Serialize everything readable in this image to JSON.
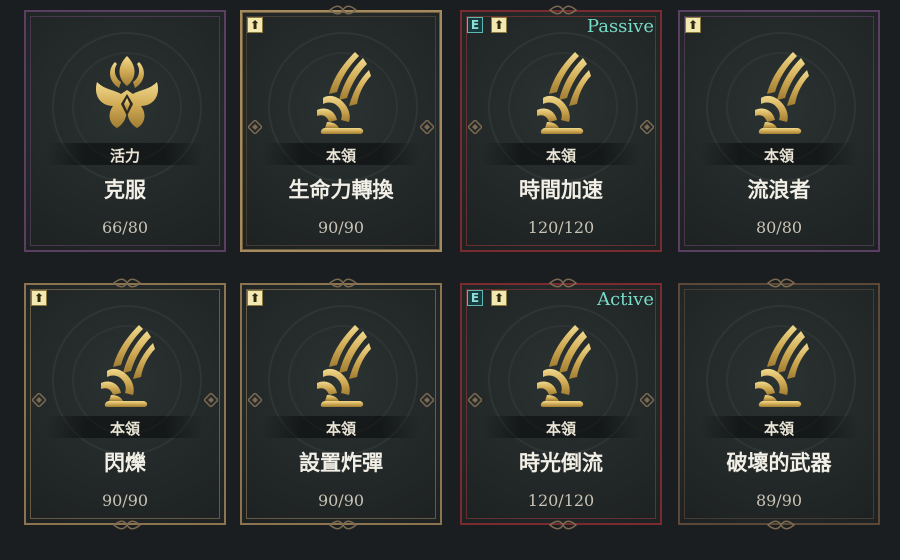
{
  "colors": {
    "emblem_gold": "#d9b763",
    "text_primary": "#f2efe6",
    "mode_text": "#77dcc8",
    "border_red": "#7a2b2f",
    "border_purple": "#5a3f63",
    "border_gold": "#8b744f"
  },
  "cards": [
    {
      "emblem": "lotus-flame-emblem",
      "category": "活力",
      "name": "克服",
      "progress": "66/80",
      "upgrade": false,
      "e_tag": false,
      "mode": ""
    },
    {
      "emblem": "wing-emblem",
      "category": "本領",
      "name": "生命力轉換",
      "progress": "90/90",
      "upgrade": true,
      "e_tag": false,
      "mode": ""
    },
    {
      "emblem": "wing-emblem",
      "category": "本領",
      "name": "時間加速",
      "progress": "120/120",
      "upgrade": true,
      "e_tag": true,
      "e_label": "E",
      "mode": "Passive"
    },
    {
      "emblem": "wing-emblem",
      "category": "本領",
      "name": "流浪者",
      "progress": "80/80",
      "upgrade": true,
      "e_tag": false,
      "mode": ""
    },
    {
      "emblem": "wing-emblem",
      "category": "本領",
      "name": "閃爍",
      "progress": "90/90",
      "upgrade": true,
      "e_tag": false,
      "mode": ""
    },
    {
      "emblem": "wing-emblem",
      "category": "本領",
      "name": "設置炸彈",
      "progress": "90/90",
      "upgrade": true,
      "e_tag": false,
      "mode": ""
    },
    {
      "emblem": "wing-emblem",
      "category": "本領",
      "name": "時光倒流",
      "progress": "120/120",
      "upgrade": true,
      "e_tag": true,
      "e_label": "E",
      "mode": "Active"
    },
    {
      "emblem": "wing-emblem",
      "category": "本領",
      "name": "破壞的武器",
      "progress": "89/90",
      "upgrade": false,
      "e_tag": false,
      "mode": ""
    }
  ]
}
